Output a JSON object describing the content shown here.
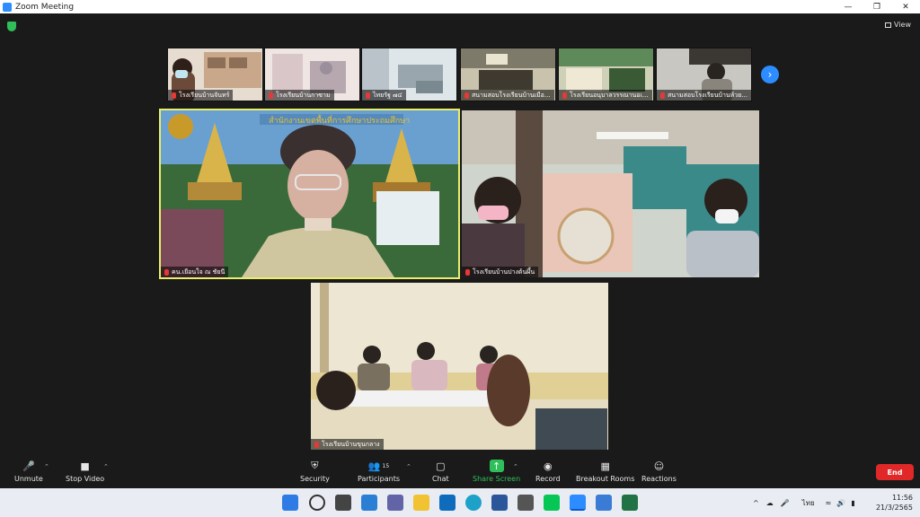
{
  "window": {
    "title": "Zoom Meeting"
  },
  "view_label": "View",
  "gallery_strip": [
    {
      "label": "โรงเรียนบ้านจันทร์",
      "colors": [
        "#c8a78a",
        "#6b4a3a",
        "#e0d8d0"
      ]
    },
    {
      "label": "โรงเรียนบ้านกาซาม",
      "colors": [
        "#d9c6c8",
        "#9a8f9a",
        "#efe6e4"
      ]
    },
    {
      "label": "ไทยรัฐ ๗๔",
      "colors": [
        "#b9c3c9",
        "#7a8890",
        "#dfe6ea"
      ]
    },
    {
      "label": "สนามสอบโรงเรียนบ้านเมือ...",
      "colors": [
        "#7d7a6a",
        "#3e3a30",
        "#c9c3ae"
      ]
    },
    {
      "label": "โรงเรียนอนุบาลวรรณานอเ...",
      "colors": [
        "#5e8a5a",
        "#cfd0b8",
        "#3a5a36"
      ]
    },
    {
      "label": "สนามสอบโรงเรียนบ้านห้วย...",
      "colors": [
        "#c9c7c2",
        "#3b3833",
        "#8a857c"
      ]
    }
  ],
  "main_tiles": [
    {
      "label": "คน.เยือนใจ ณ ชัยนี",
      "colors": [
        "#3b6a3a",
        "#d9b44a",
        "#6aa0d0"
      ]
    },
    {
      "label": "โรงเรียนบ้านปางต้นผึ้น",
      "colors": [
        "#c9c3b8",
        "#3a8a8a",
        "#e9c6b8"
      ]
    },
    {
      "label": "โรงเรียนบ้านขุนกลาง",
      "colors": [
        "#e6dcc2",
        "#bfb08a",
        "#404a52"
      ]
    }
  ],
  "banner_text": "สำนักงานเขตพื้นที่การศึกษาประถมศึกษา",
  "toolbar": {
    "unmute": "Unmute",
    "stop_video": "Stop Video",
    "security": "Security",
    "participants": "Participants",
    "participants_count": "15",
    "chat": "Chat",
    "share_screen": "Share Screen",
    "record": "Record",
    "breakout_rooms": "Breakout Rooms",
    "reactions": "Reactions",
    "end": "End"
  },
  "taskbar": {
    "lang": "ไทย",
    "time": "11:56",
    "date": "21/3/2565",
    "tray_arrow": "^"
  },
  "colors": {
    "zoom_blue": "#2d8cff",
    "share_green": "#2fbf5a",
    "end_red": "#e02828",
    "speaker_border": "#e9ee6b"
  }
}
